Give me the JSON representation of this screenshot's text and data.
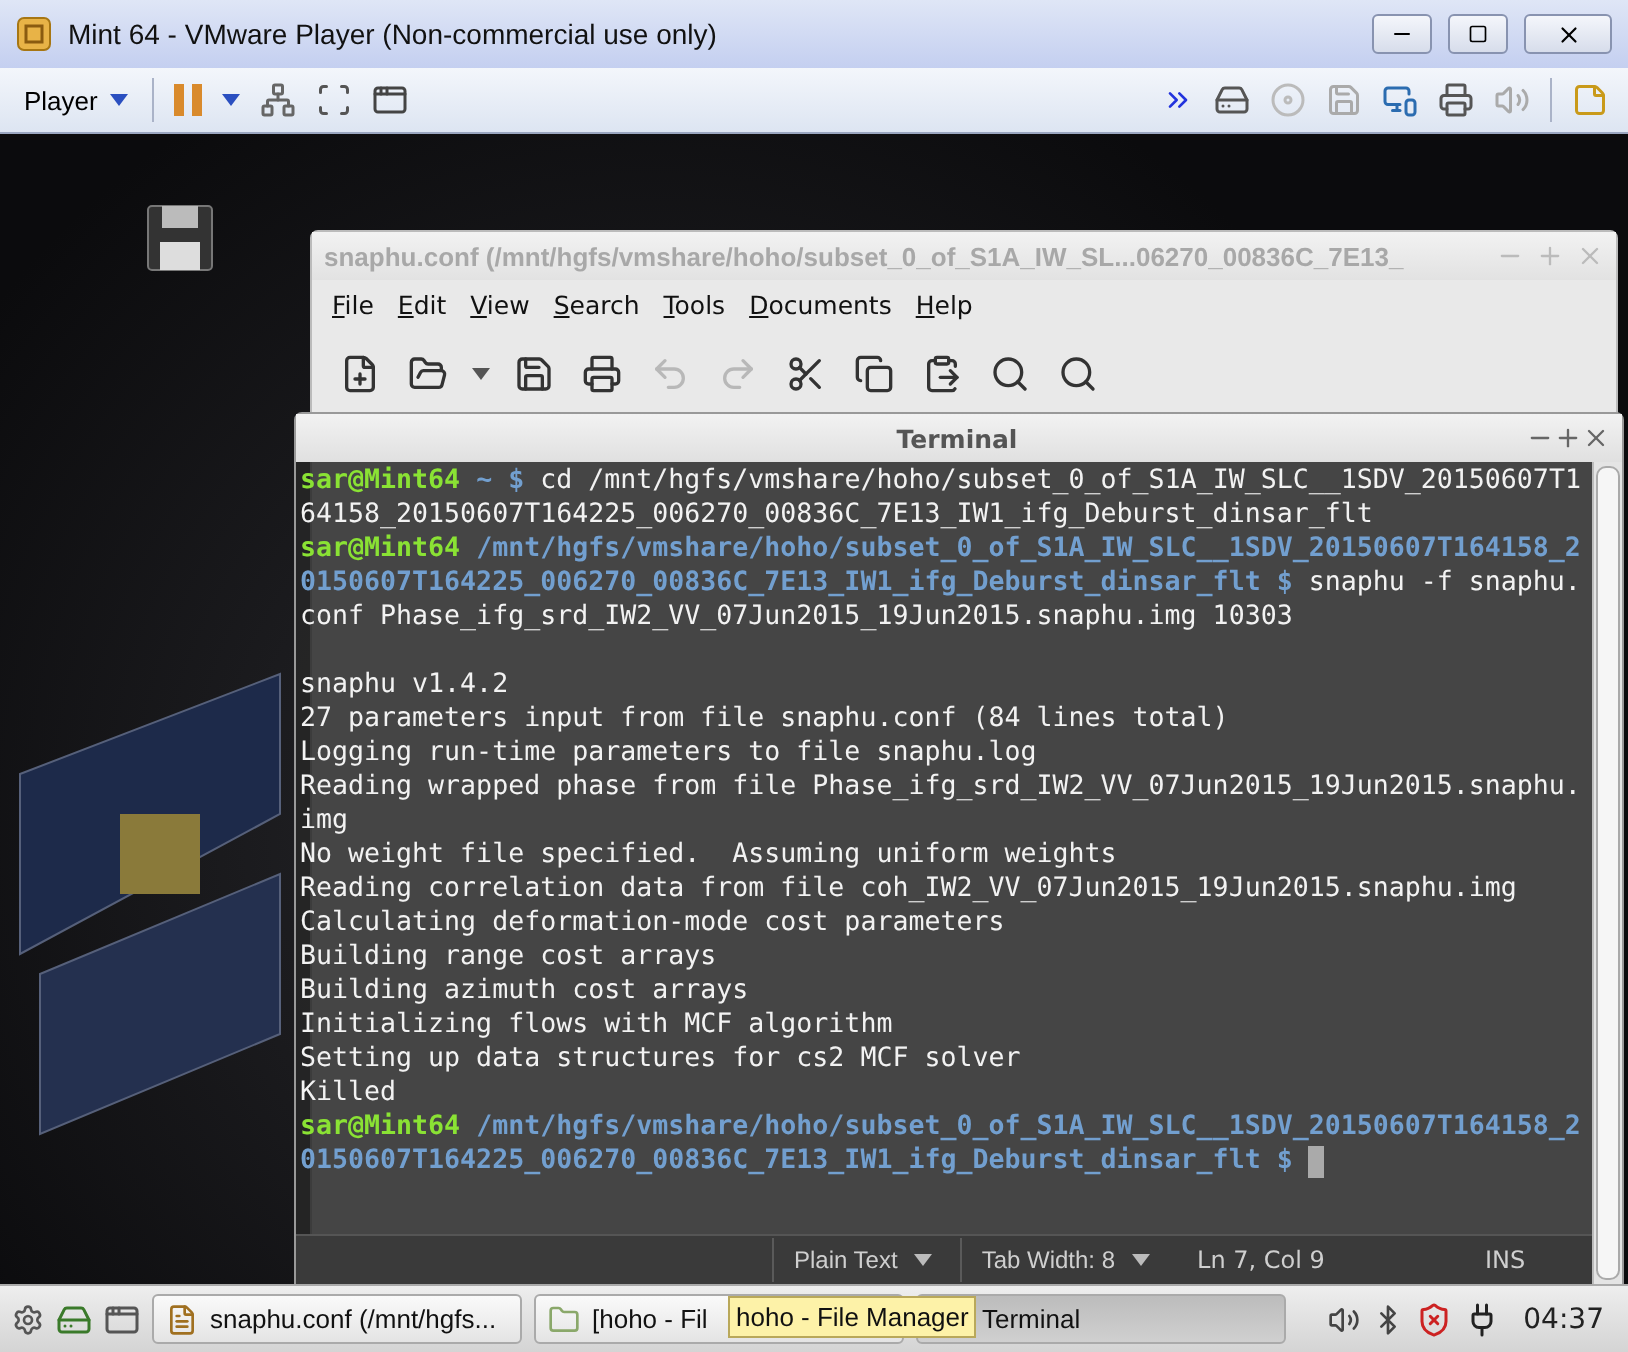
{
  "vm_window": {
    "title": "Mint 64 - VMware Player (Non-commercial use only)"
  },
  "vm_toolbar": {
    "player_menu": "Player"
  },
  "editor": {
    "title": "snaphu.conf (/mnt/hgfs/vmshare/hoho/subset_0_of_S1A_IW_SL...06270_00836C_7E13_",
    "menu": [
      "File",
      "Edit",
      "View",
      "Search",
      "Tools",
      "Documents",
      "Help"
    ],
    "status_bar": [
      {
        "kind": "dropdown",
        "text": "Plain Text"
      },
      {
        "kind": "dropdown",
        "text": "Tab Width:  8"
      },
      {
        "kind": "text",
        "text": "Ln 7, Col 9"
      },
      {
        "kind": "text",
        "text": "INS"
      }
    ]
  },
  "terminal": {
    "title": "Terminal",
    "lines": [
      {
        "kind": "text",
        "segments": [
          {
            "kind": "user",
            "text": "sar@Mint64"
          },
          {
            "kind": "path",
            "text": " ~ $"
          },
          {
            "kind": "output",
            "text": " cd /mnt/hgfs/vmshare/hoho/subset_0_of_S1A_IW_SLC__1SDV_20150607T1"
          }
        ]
      },
      {
        "kind": "text",
        "segments": [
          {
            "kind": "output",
            "text": "64158_20150607T164225_006270_00836C_7E13_IW1_ifg_Deburst_dinsar_flt"
          }
        ]
      },
      {
        "kind": "text",
        "segments": [
          {
            "kind": "user",
            "text": "sar@Mint64"
          },
          {
            "kind": "path",
            "text": " /mnt/hgfs/vmshare/hoho/subset_0_of_S1A_IW_SLC__1SDV_20150607T164158_2"
          }
        ]
      },
      {
        "kind": "text",
        "segments": [
          {
            "kind": "path",
            "text": "0150607T164225_006270_00836C_7E13_IW1_ifg_Deburst_dinsar_flt $"
          },
          {
            "kind": "output",
            "text": " snaphu -f snaphu."
          }
        ]
      },
      {
        "kind": "text",
        "segments": [
          {
            "kind": "output",
            "text": "conf Phase_ifg_srd_IW2_VV_07Jun2015_19Jun2015.snaphu.img 10303"
          }
        ]
      },
      {
        "kind": "blank"
      },
      {
        "kind": "text",
        "segments": [
          {
            "kind": "output",
            "text": "snaphu v1.4.2"
          }
        ]
      },
      {
        "kind": "text",
        "segments": [
          {
            "kind": "output",
            "text": "27 parameters input from file snaphu.conf (84 lines total)"
          }
        ]
      },
      {
        "kind": "text",
        "segments": [
          {
            "kind": "output",
            "text": "Logging run-time parameters to file snaphu.log"
          }
        ]
      },
      {
        "kind": "text",
        "segments": [
          {
            "kind": "output",
            "text": "Reading wrapped phase from file Phase_ifg_srd_IW2_VV_07Jun2015_19Jun2015.snaphu."
          }
        ]
      },
      {
        "kind": "text",
        "segments": [
          {
            "kind": "output",
            "text": "img"
          }
        ]
      },
      {
        "kind": "text",
        "segments": [
          {
            "kind": "output",
            "text": "No weight file specified.  Assuming uniform weights"
          }
        ]
      },
      {
        "kind": "text",
        "segments": [
          {
            "kind": "output",
            "text": "Reading correlation data from file coh_IW2_VV_07Jun2015_19Jun2015.snaphu.img"
          }
        ]
      },
      {
        "kind": "text",
        "segments": [
          {
            "kind": "output",
            "text": "Calculating deformation-mode cost parameters"
          }
        ]
      },
      {
        "kind": "text",
        "segments": [
          {
            "kind": "output",
            "text": "Building range cost arrays"
          }
        ]
      },
      {
        "kind": "text",
        "segments": [
          {
            "kind": "output",
            "text": "Building azimuth cost arrays"
          }
        ]
      },
      {
        "kind": "text",
        "segments": [
          {
            "kind": "output",
            "text": "Initializing flows with MCF algorithm"
          }
        ]
      },
      {
        "kind": "text",
        "segments": [
          {
            "kind": "output",
            "text": "Setting up data structures for cs2 MCF solver"
          }
        ]
      },
      {
        "kind": "text",
        "segments": [
          {
            "kind": "output",
            "text": "Killed"
          }
        ]
      },
      {
        "kind": "text",
        "segments": [
          {
            "kind": "user",
            "text": "sar@Mint64"
          },
          {
            "kind": "path",
            "text": " /mnt/hgfs/vmshare/hoho/subset_0_of_S1A_IW_SLC__1SDV_20150607T164158_2"
          }
        ]
      },
      {
        "kind": "text",
        "segments": [
          {
            "kind": "path",
            "text": "0150607T164225_006270_00836C_7E13_IW1_ifg_Deburst_dinsar_flt $"
          }
        ],
        "cursor": true
      }
    ]
  },
  "taskbar": {
    "tasks": [
      {
        "kind": "editor",
        "label": "snaphu.conf (/mnt/hgfs...",
        "selected": false
      },
      {
        "kind": "folder",
        "label": "[hoho - Fil",
        "selected": false
      },
      {
        "kind": "terminal",
        "label": "Terminal",
        "selected": true
      }
    ],
    "tooltip": "hoho - File Manager",
    "clock": "04:37"
  }
}
